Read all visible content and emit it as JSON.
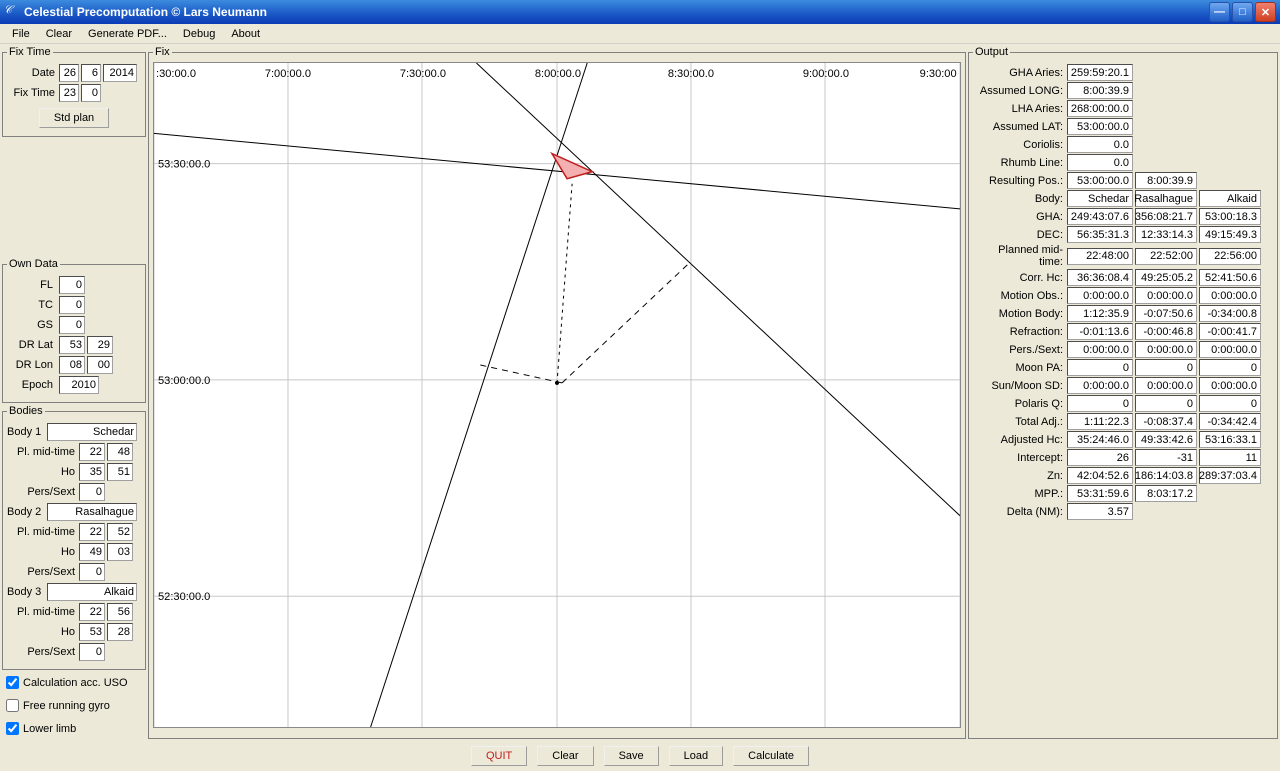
{
  "window": {
    "title": "Celestial Precomputation © Lars Neumann"
  },
  "menu": {
    "file": "File",
    "clear": "Clear",
    "generate_pdf": "Generate PDF...",
    "debug": "Debug",
    "about": "About"
  },
  "fix_time": {
    "legend": "Fix Time",
    "date_label": "Date",
    "date_d": "26",
    "date_m": "6",
    "date_y": "2014",
    "time_label": "Fix Time",
    "time_h": "23",
    "time_m": "0",
    "std_plan": "Std plan"
  },
  "own_data": {
    "legend": "Own Data",
    "fl_label": "FL",
    "fl": "0",
    "tc_label": "TC",
    "tc": "0",
    "gs_label": "GS",
    "gs": "0",
    "drlat_label": "DR Lat",
    "drlat_d": "53",
    "drlat_m": "29",
    "drlon_label": "DR Lon",
    "drlon_d": "08",
    "drlon_m": "00",
    "epoch_label": "Epoch",
    "epoch": "2010"
  },
  "bodies": {
    "legend": "Bodies",
    "b1_label": "Body 1",
    "b1_name": "Schedar",
    "b1_mid_label": "Pl. mid-time",
    "b1_mid_h": "22",
    "b1_mid_m": "48",
    "b1_ho_label": "Ho",
    "b1_ho_d": "35",
    "b1_ho_m": "51",
    "b1_ps_label": "Pers/Sext",
    "b1_ps": "0",
    "b2_label": "Body 2",
    "b2_name": "Rasalhague",
    "b2_mid_label": "Pl. mid-time",
    "b2_mid_h": "22",
    "b2_mid_m": "52",
    "b2_ho_label": "Ho",
    "b2_ho_d": "49",
    "b2_ho_m": "03",
    "b2_ps_label": "Pers/Sext",
    "b2_ps": "0",
    "b3_label": "Body 3",
    "b3_name": "Alkaid",
    "b3_mid_label": "Pl. mid-time",
    "b3_mid_h": "22",
    "b3_mid_m": "56",
    "b3_ho_label": "Ho",
    "b3_ho_d": "53",
    "b3_ho_m": "28",
    "b3_ps_label": "Pers/Sext",
    "b3_ps": "0"
  },
  "options": {
    "calc_uso": "Calculation acc. USO",
    "calc_uso_checked": true,
    "free_gyro": "Free running gyro",
    "free_gyro_checked": false,
    "lower_limb": "Lower limb",
    "lower_limb_checked": true
  },
  "fix": {
    "legend": "Fix"
  },
  "plot": {
    "x_labels": [
      ":30:00.0",
      "7:00:00.0",
      "7:30:00.0",
      "8:00:00.0",
      "8:30:00.0",
      "9:00:00.0",
      "9:30:00"
    ],
    "y_labels": [
      "53:30:00.0",
      "53:00:00.0",
      "52:30:00.0"
    ]
  },
  "output": {
    "legend": "Output",
    "rows_single": [
      {
        "label": "GHA Aries:",
        "v": "259:59:20.1"
      },
      {
        "label": "Assumed LONG:",
        "v": "8:00:39.9"
      },
      {
        "label": "LHA Aries:",
        "v": "268:00:00.0"
      },
      {
        "label": "Assumed LAT:",
        "v": "53:00:00.0"
      },
      {
        "label": "Coriolis:",
        "v": "0.0"
      },
      {
        "label": "Rhumb Line:",
        "v": "0.0"
      }
    ],
    "resulting_pos": {
      "label": "Resulting Pos.:",
      "v1": "53:00:00.0",
      "v2": "8:00:39.9"
    },
    "body_header": {
      "label": "Body:",
      "c1": "Schedar",
      "c2": "Rasalhague",
      "c3": "Alkaid"
    },
    "rows_triple": [
      {
        "label": "GHA:",
        "c1": "249:43:07.6",
        "c2": "356:08:21.7",
        "c3": "53:00:18.3"
      },
      {
        "label": "DEC:",
        "c1": "56:35:31.3",
        "c2": "12:33:14.3",
        "c3": "49:15:49.3"
      },
      {
        "label": "Planned mid-time:",
        "c1": "22:48:00",
        "c2": "22:52:00",
        "c3": "22:56:00"
      },
      {
        "label": "Corr. Hc:",
        "c1": "36:36:08.4",
        "c2": "49:25:05.2",
        "c3": "52:41:50.6"
      },
      {
        "label": "Motion Obs.:",
        "c1": "0:00:00.0",
        "c2": "0:00:00.0",
        "c3": "0:00:00.0"
      },
      {
        "label": "Motion Body:",
        "c1": "1:12:35.9",
        "c2": "-0:07:50.6",
        "c3": "-0:34:00.8"
      },
      {
        "label": "Refraction:",
        "c1": "-0:01:13.6",
        "c2": "-0:00:46.8",
        "c3": "-0:00:41.7"
      },
      {
        "label": "Pers./Sext:",
        "c1": "0:00:00.0",
        "c2": "0:00:00.0",
        "c3": "0:00:00.0"
      },
      {
        "label": "Moon PA:",
        "c1": "0",
        "c2": "0",
        "c3": "0"
      },
      {
        "label": "Sun/Moon SD:",
        "c1": "0:00:00.0",
        "c2": "0:00:00.0",
        "c3": "0:00:00.0"
      },
      {
        "label": "Polaris Q:",
        "c1": "0",
        "c2": "0",
        "c3": "0"
      },
      {
        "label": "Total Adj.:",
        "c1": "1:11:22.3",
        "c2": "-0:08:37.4",
        "c3": "-0:34:42.4"
      },
      {
        "label": "Adjusted Hc:",
        "c1": "35:24:46.0",
        "c2": "49:33:42.6",
        "c3": "53:16:33.1"
      },
      {
        "label": "Intercept:",
        "c1": "26",
        "c2": "-31",
        "c3": "11"
      },
      {
        "label": "Zn:",
        "c1": "42:04:52.6",
        "c2": "186:14:03.8",
        "c3": "289:37:03.4"
      }
    ],
    "mpp": {
      "label": "MPP.:",
      "v1": "53:31:59.6",
      "v2": "8:03:17.2"
    },
    "delta": {
      "label": "Delta (NM):",
      "v": "3.57"
    }
  },
  "buttons": {
    "quit": "QUIT",
    "clear": "Clear",
    "save": "Save",
    "load": "Load",
    "calculate": "Calculate"
  }
}
